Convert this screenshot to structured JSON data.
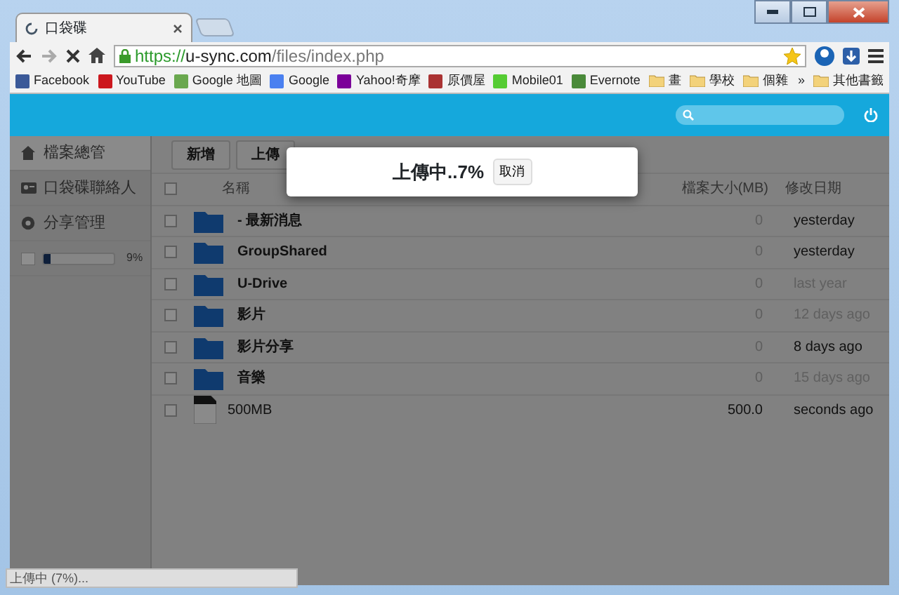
{
  "browser": {
    "tab_title": "口袋碟",
    "loading": true,
    "url_scheme": "https://",
    "url_host": "u-sync.com",
    "url_path": "/files/index.php",
    "bookmarks": [
      {
        "label": "Facebook",
        "kind": "facebook"
      },
      {
        "label": "YouTube",
        "kind": "youtube"
      },
      {
        "label": "Google 地圖",
        "kind": "maps"
      },
      {
        "label": "Google",
        "kind": "google"
      },
      {
        "label": "Yahoo!奇摩",
        "kind": "yahoo"
      },
      {
        "label": "原價屋",
        "kind": "shop"
      },
      {
        "label": "Mobile01",
        "kind": "mobile"
      },
      {
        "label": "Evernote",
        "kind": "evernote"
      },
      {
        "label": "畫",
        "kind": "folder"
      },
      {
        "label": "學校",
        "kind": "folder"
      },
      {
        "label": "個雜",
        "kind": "folder"
      }
    ],
    "more": "»",
    "other_bookmarks": "其他書籤"
  },
  "sidebar": {
    "items": [
      {
        "label": "檔案總管",
        "selected": true
      },
      {
        "label": "口袋碟聯絡人",
        "selected": false
      },
      {
        "label": "分享管理",
        "selected": false
      }
    ],
    "storage": {
      "level": 0.09,
      "reading": "9%"
    }
  },
  "toolbar": {
    "buttons": [
      "新增",
      "上傳"
    ]
  },
  "table": {
    "select_all_checked": false,
    "columns": [
      "名稱",
      "檔案大小(MB)",
      "修改日期"
    ],
    "rows": [
      {
        "kind": "folder",
        "name": "- 最新消息",
        "size": "0",
        "date": "yesterday",
        "date_muted": false,
        "checked": false
      },
      {
        "kind": "folder",
        "name": "GroupShared",
        "size": "0",
        "date": "yesterday",
        "date_muted": false,
        "checked": false
      },
      {
        "kind": "folder",
        "name": "U-Drive",
        "size": "0",
        "date": "last year",
        "date_muted": true,
        "checked": false
      },
      {
        "kind": "folder",
        "name": "影片",
        "size": "0",
        "date": "12 days ago",
        "date_muted": true,
        "checked": false
      },
      {
        "kind": "folder",
        "name": "影片分享",
        "size": "0",
        "date": "8 days ago",
        "date_muted": false,
        "checked": false
      },
      {
        "kind": "folder",
        "name": "音樂",
        "size": "0",
        "date": "15 days ago",
        "date_muted": true,
        "checked": false
      },
      {
        "kind": "file",
        "name": "500MB",
        "size": "500.0",
        "date": "seconds ago",
        "date_muted": false,
        "checked": false
      }
    ]
  },
  "dialog": {
    "message": "上傳中..7%",
    "button": "取消"
  },
  "status_bar": "上傳中 (7%)..."
}
